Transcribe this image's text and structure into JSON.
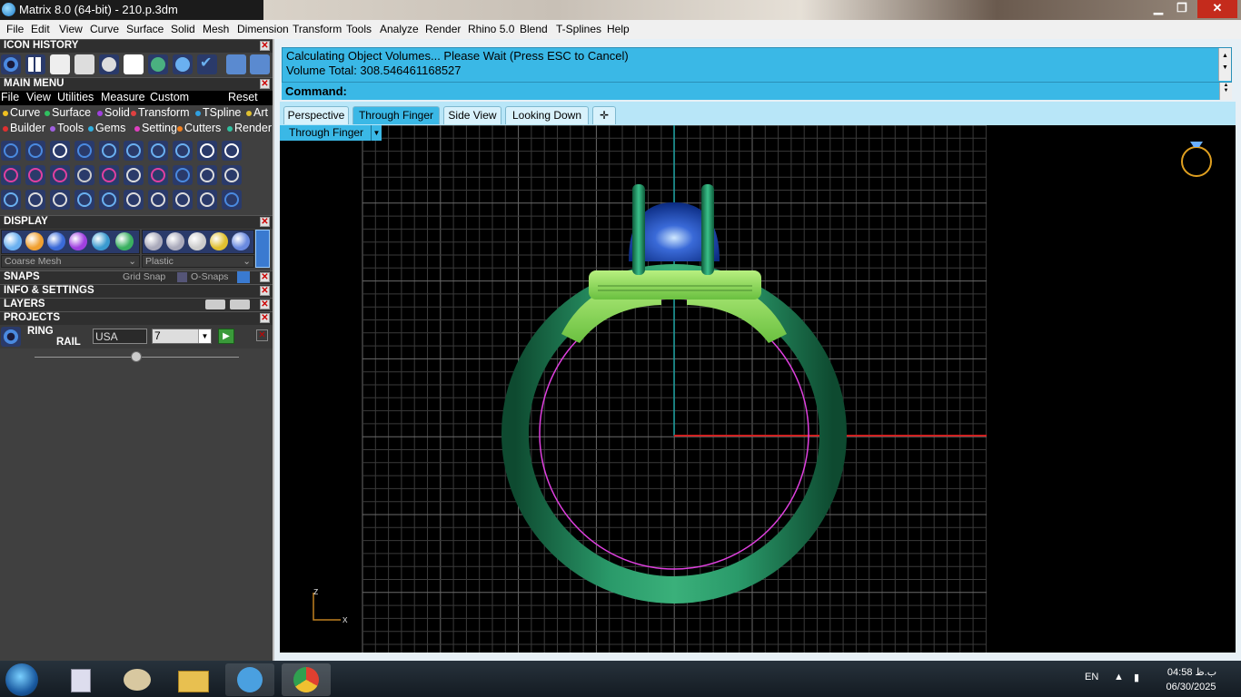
{
  "window": {
    "title": "Matrix 8.0 (64-bit) - 210.p.3dm",
    "minimize": "▁",
    "restore": "❐",
    "close": "✕"
  },
  "menubar": [
    "File",
    "Edit",
    "View",
    "Curve",
    "Surface",
    "Solid",
    "Mesh",
    "Dimension",
    "Transform",
    "Tools",
    "Analyze",
    "Render",
    "Rhino 5.0",
    "Blend",
    "T-Splines",
    "Help"
  ],
  "left": {
    "icon_history": "ICON HISTORY",
    "main_menu": "MAIN MENU",
    "main_menu_items": [
      "File",
      "View",
      "Utilities",
      "Measure",
      "Custom",
      "Reset"
    ],
    "categories_row1": [
      {
        "label": "Curve",
        "color": "#f0c020"
      },
      {
        "label": "Surface",
        "color": "#30c060"
      },
      {
        "label": "Solid",
        "color": "#a040e0"
      },
      {
        "label": "Transform",
        "color": "#e04040"
      },
      {
        "label": "TSpline",
        "color": "#30a0e0"
      },
      {
        "label": "Art",
        "color": "#e0c030"
      }
    ],
    "categories_row2": [
      {
        "label": "Builder",
        "color": "#e03030"
      },
      {
        "label": "Tools",
        "color": "#a060e0"
      },
      {
        "label": "Gems",
        "color": "#30b0e0"
      },
      {
        "label": "Setting",
        "color": "#e040c0"
      },
      {
        "label": "Cutters",
        "color": "#f08020"
      },
      {
        "label": "Render",
        "color": "#30c0a0"
      }
    ],
    "display": "DISPLAY",
    "mesh_select": "Coarse Mesh",
    "material_select": "Plastic",
    "snaps": "SNAPS",
    "grid_snap": "Grid Snap",
    "osnaps": "O-Snaps",
    "info": "INFO & SETTINGS",
    "layers": "LAYERS",
    "projects": "PROJECTS",
    "ring_label": "RING",
    "rail_label": "RAIL",
    "size_system": "USA",
    "ring_size": "7"
  },
  "command": {
    "line1": "Calculating Object Volumes... Please Wait (Press ESC to Cancel)",
    "line2": "Volume Total: 308.546461168527",
    "prompt": "Command:",
    "value": ""
  },
  "tabs": [
    {
      "label": "Perspective",
      "active": false
    },
    {
      "label": "Through Finger",
      "active": true
    },
    {
      "label": "Side View",
      "active": false
    },
    {
      "label": "Looking Down",
      "active": false
    }
  ],
  "add_tab": "✛",
  "viewport": {
    "label": "Through Finger",
    "axis_z": "z",
    "axis_x": "x"
  },
  "taskbar": {
    "lang": "EN",
    "time": "04:58 ب.ظ",
    "date": "06/30/2025"
  }
}
